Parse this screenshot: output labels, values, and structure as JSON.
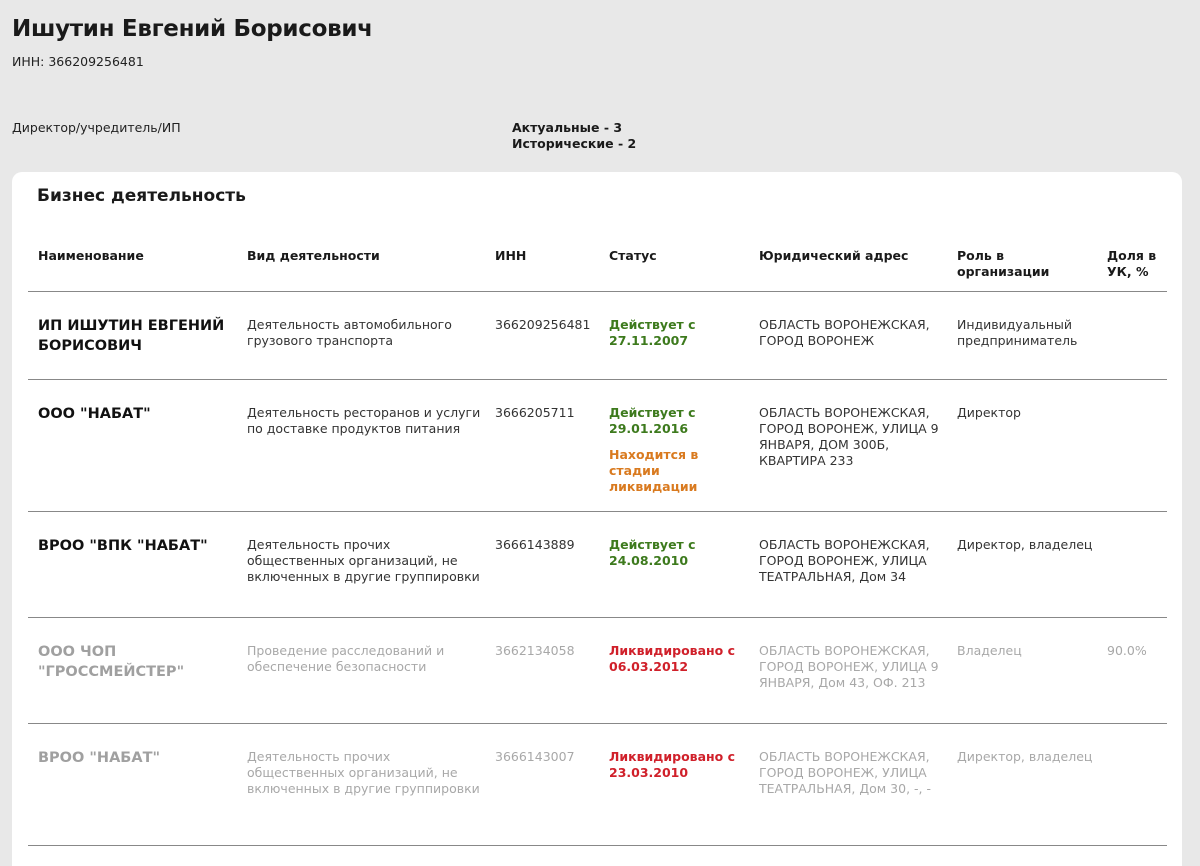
{
  "person": {
    "name": "Ишутин Евгений Борисович",
    "inn": "ИНН: 366209256481",
    "role_label": "Директор/учредитель/ИП",
    "actual": "Актуальные - 3",
    "historic": "Исторические - 2"
  },
  "business": {
    "title": "Бизнес деятельность",
    "headers": {
      "name": "Наименование",
      "activity": "Вид деятельности",
      "inn": "ИНН",
      "status": "Статус",
      "address": "Юридический адрес",
      "role": "Роль в организации",
      "share": "Доля в УК, %"
    },
    "rows": [
      {
        "name": "ИП ИШУТИН ЕВГЕНИЙ БОРИСОВИЧ",
        "activity": "Деятельность автомобильного грузового транспорта",
        "inn": "366209256481",
        "status": "Действует с 27.11.2007",
        "status2": "",
        "address": "ОБЛАСТЬ ВОРОНЕЖСКАЯ, ГОРОД ВОРОНЕЖ",
        "role": "Индивидуальный предприниматель",
        "share": ""
      },
      {
        "name": "ООО \"НАБАТ\"",
        "activity": "Деятельность ресторанов и услуги по доставке продуктов питания",
        "inn": "3666205711",
        "status": "Действует с 29.01.2016",
        "status2": "Находится в стадии ликвидации",
        "address": "ОБЛАСТЬ ВОРОНЕЖСКАЯ, ГОРОД ВОРОНЕЖ, УЛИЦА 9 ЯНВАРЯ, ДОМ 300Б, КВАРТИРА 233",
        "role": "Директор",
        "share": ""
      },
      {
        "name": "ВРОО \"ВПК \"НАБАТ\"",
        "activity": "Деятельность прочих общественных организаций, не включенных в другие группировки",
        "inn": "3666143889",
        "status": "Действует с 24.08.2010",
        "status2": "",
        "address": "ОБЛАСТЬ ВОРОНЕЖСКАЯ, ГОРОД ВОРОНЕЖ, УЛИЦА ТЕАТРАЛЬНАЯ, Дом 34",
        "role": "Директор, владелец",
        "share": ""
      },
      {
        "name": "ООО ЧОП \"ГРОССМЕЙСТЕР\"",
        "activity": "Проведение расследований и обеспечение безопасности",
        "inn": "3662134058",
        "status": "Ликвидировано с 06.03.2012",
        "status2": "",
        "address": "ОБЛАСТЬ ВОРОНЕЖСКАЯ, ГОРОД ВОРОНЕЖ, УЛИЦА 9 ЯНВАРЯ, Дом 43, ОФ. 213",
        "role": "Владелец",
        "share": "90.0%"
      },
      {
        "name": "ВРОО \"НАБАТ\"",
        "activity": "Деятельность прочих общественных организаций, не включенных в другие группировки",
        "inn": "3666143007",
        "status": "Ликвидировано с 23.03.2010",
        "status2": "",
        "address": "ОБЛАСТЬ ВОРОНЕЖСКАЯ, ГОРОД ВОРОНЕЖ, УЛИЦА ТЕАТРАЛЬНАЯ, Дом 30, -, -",
        "role": "Директор, владелец",
        "share": ""
      }
    ]
  },
  "colors": {
    "active": "#3d7a1d",
    "liquidating": "#d97a1f",
    "liquidated": "#d0202a",
    "background": "#e8e8e8"
  }
}
